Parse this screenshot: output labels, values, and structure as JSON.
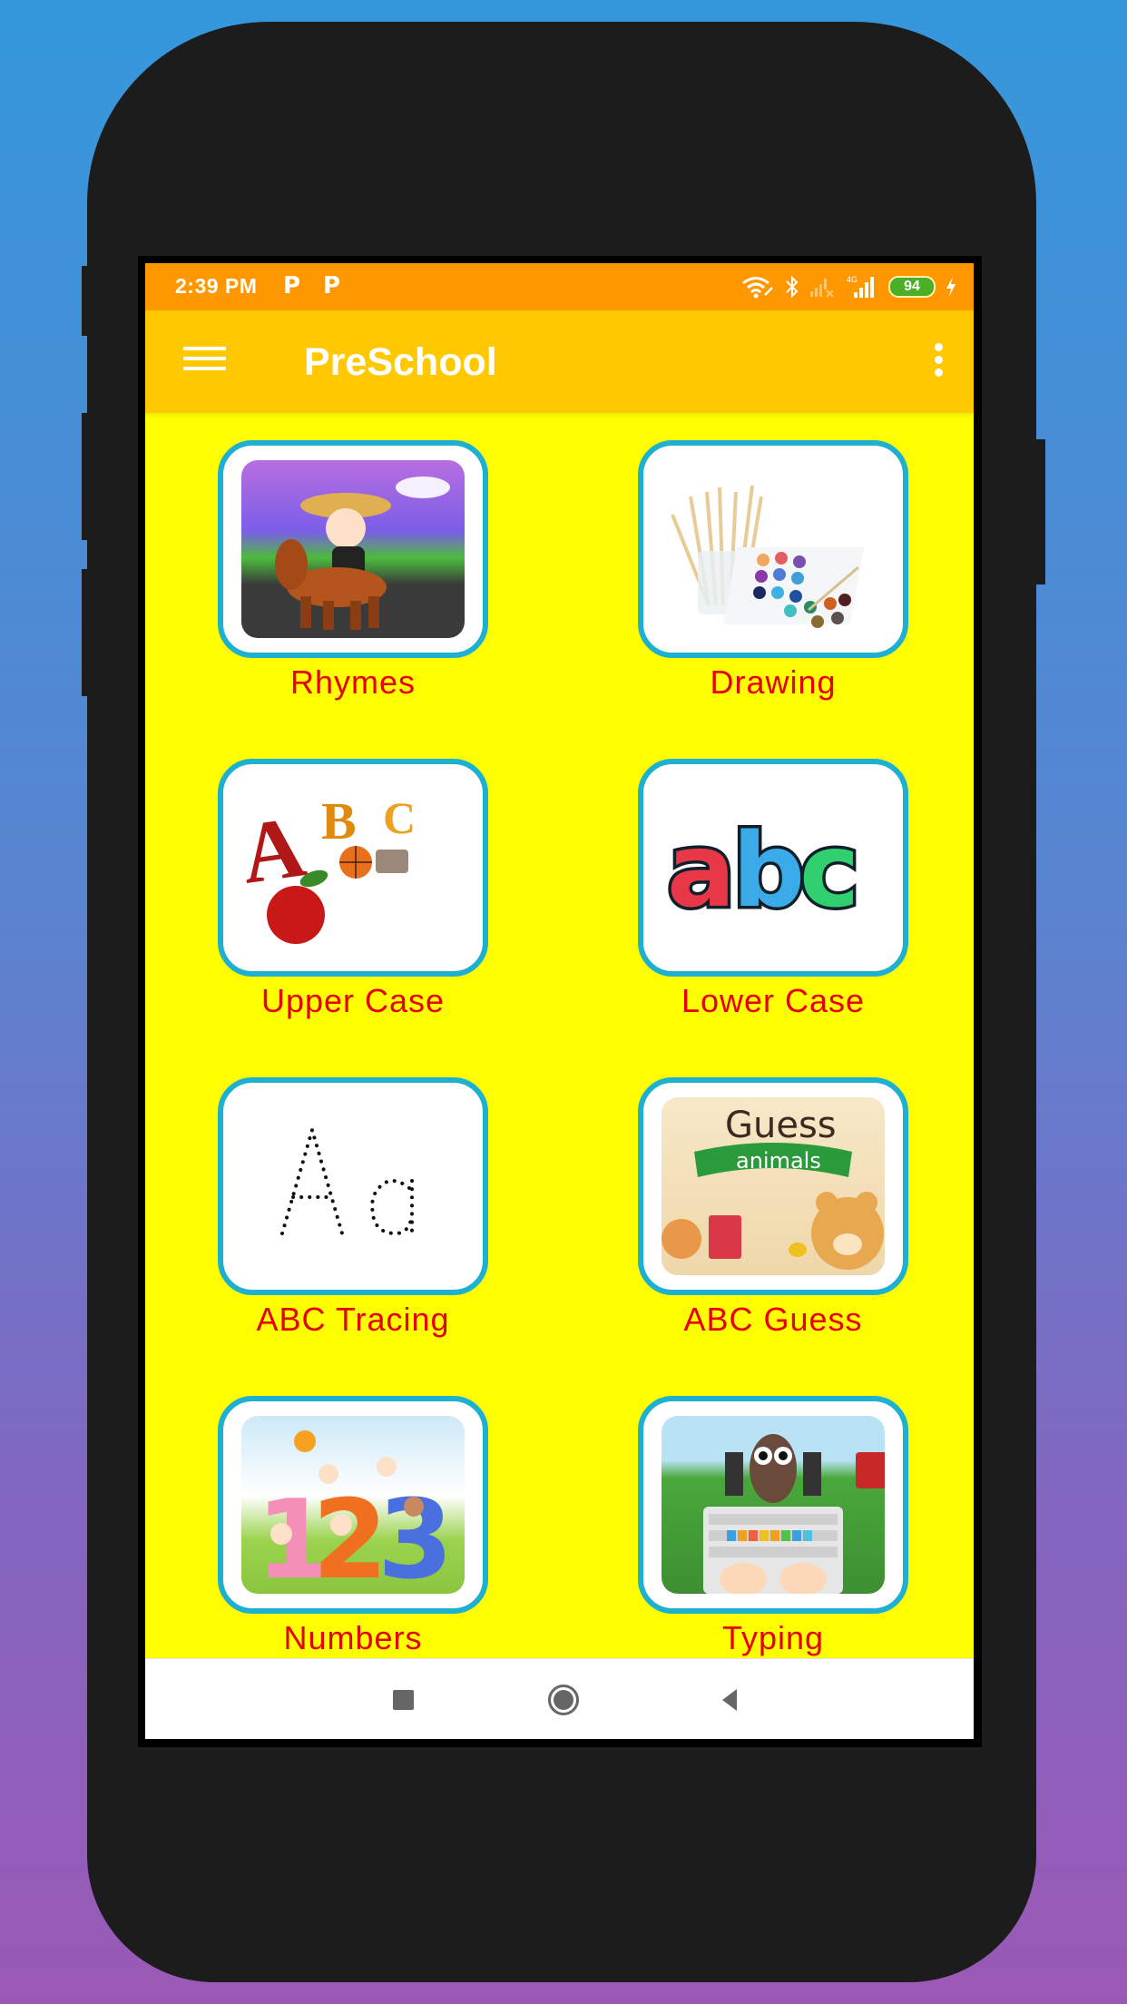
{
  "status_bar": {
    "time": "2:39 PM",
    "notification_icons": [
      "p-app-icon",
      "p-app-icon"
    ],
    "battery_level": "94",
    "right_icons": [
      "wifi-icon",
      "bluetooth-icon",
      "signal-sim1-icon",
      "signal-4g-icon",
      "battery-icon",
      "charging-icon"
    ],
    "network_label": "4G"
  },
  "app_bar": {
    "title": "PreSchool",
    "menu_icon": "hamburger-menu-icon",
    "overflow_icon": "more-vert-icon"
  },
  "tiles": [
    {
      "label": "Rhymes",
      "image": "boy-riding-horse"
    },
    {
      "label": "Drawing",
      "image": "paint-brushes-watercolor"
    },
    {
      "label": "Upper Case",
      "image": "ABC-apple-ball-cat"
    },
    {
      "label": "Lower Case",
      "image": "abc-colorful-letters"
    },
    {
      "label": "ABC Tracing",
      "image": "dotted-Aa"
    },
    {
      "label": "ABC Guess",
      "image": "guess-animals-bear",
      "image_text": [
        "Guess",
        "animals"
      ]
    },
    {
      "label": "Numbers",
      "image": "kids-on-123"
    },
    {
      "label": "Typing",
      "image": "owl-keyboard-graduates"
    }
  ],
  "nav_bar": {
    "recent": "recent-apps",
    "home": "home",
    "back": "back"
  },
  "colors": {
    "status_bar": "#ff9800",
    "app_bar": "#ffc800",
    "background": "#ffff00",
    "card_border": "#1eb0d0",
    "label": "#e60000"
  }
}
